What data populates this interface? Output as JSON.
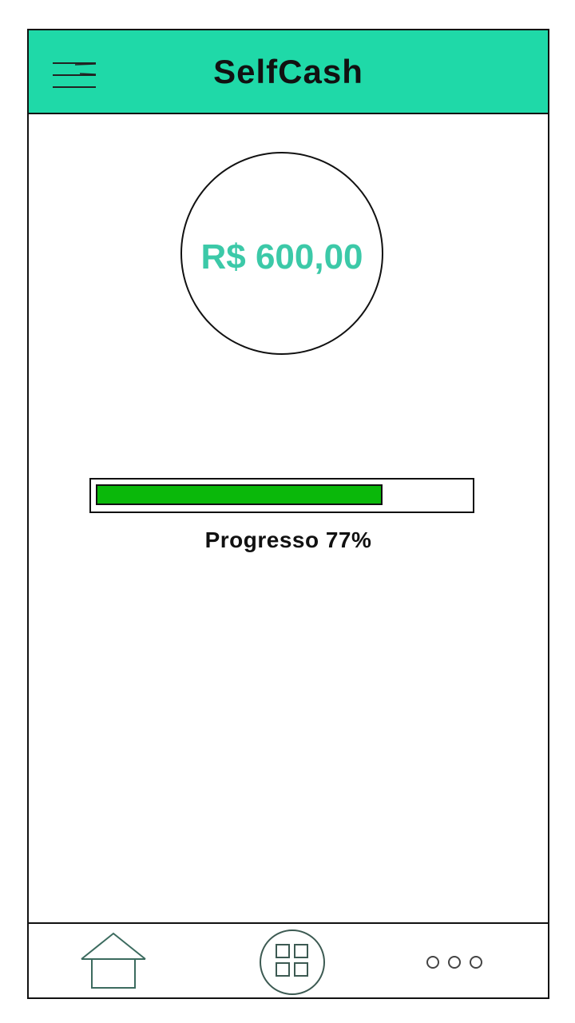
{
  "header": {
    "title": "SelfCash",
    "menu_icon": "hamburger-menu-icon",
    "background_color": "#1fd9a8"
  },
  "balance": {
    "value": "R$ 600,00",
    "text_color": "#3cc9a8"
  },
  "progress": {
    "label": "Progresso 77%",
    "percent": 77,
    "fill_color": "#0ab80a"
  },
  "bottom_nav": {
    "items": [
      {
        "icon": "home-icon"
      },
      {
        "icon": "grid-icon"
      },
      {
        "icon": "more-icon"
      }
    ]
  }
}
